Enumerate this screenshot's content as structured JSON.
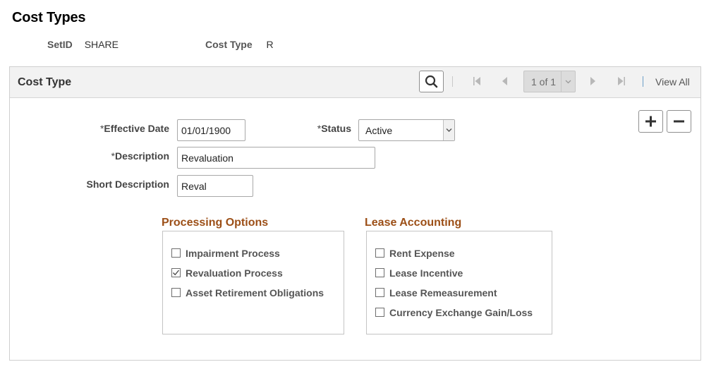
{
  "page": {
    "title": "Cost Types"
  },
  "keys": {
    "setid_label": "SetID",
    "setid_value": "SHARE",
    "cost_type_label": "Cost Type",
    "cost_type_value": "R"
  },
  "panel": {
    "title": "Cost Type",
    "pager_text": "1 of 1",
    "view_all": "View All"
  },
  "form": {
    "effective_date_label": "Effective Date",
    "effective_date_value": "01/01/1900",
    "status_label": "Status",
    "status_value": "Active",
    "description_label": "Description",
    "description_value": "Revaluation",
    "short_description_label": "Short Description",
    "short_description_value": "Reval",
    "required_mark": "*"
  },
  "processing_options": {
    "title": "Processing Options",
    "items": [
      {
        "label": "Impairment Process",
        "checked": false
      },
      {
        "label": "Revaluation Process",
        "checked": true
      },
      {
        "label": "Asset Retirement Obligations",
        "checked": false
      }
    ]
  },
  "lease_accounting": {
    "title": "Lease Accounting",
    "items": [
      {
        "label": "Rent Expense",
        "checked": false
      },
      {
        "label": "Lease Incentive",
        "checked": false
      },
      {
        "label": "Lease Remeasurement",
        "checked": false
      },
      {
        "label": "Currency Exchange Gain/Loss",
        "checked": false
      }
    ]
  },
  "colors": {
    "group_title": "#9c4f17",
    "header_bg": "#f2f2f2",
    "pager_bg": "#dcdcdc"
  },
  "icons": {
    "search": "search-icon",
    "first": "first-page-icon",
    "prev": "previous-icon",
    "next": "next-icon",
    "last": "last-page-icon",
    "add": "plus-icon",
    "delete": "minus-icon"
  }
}
